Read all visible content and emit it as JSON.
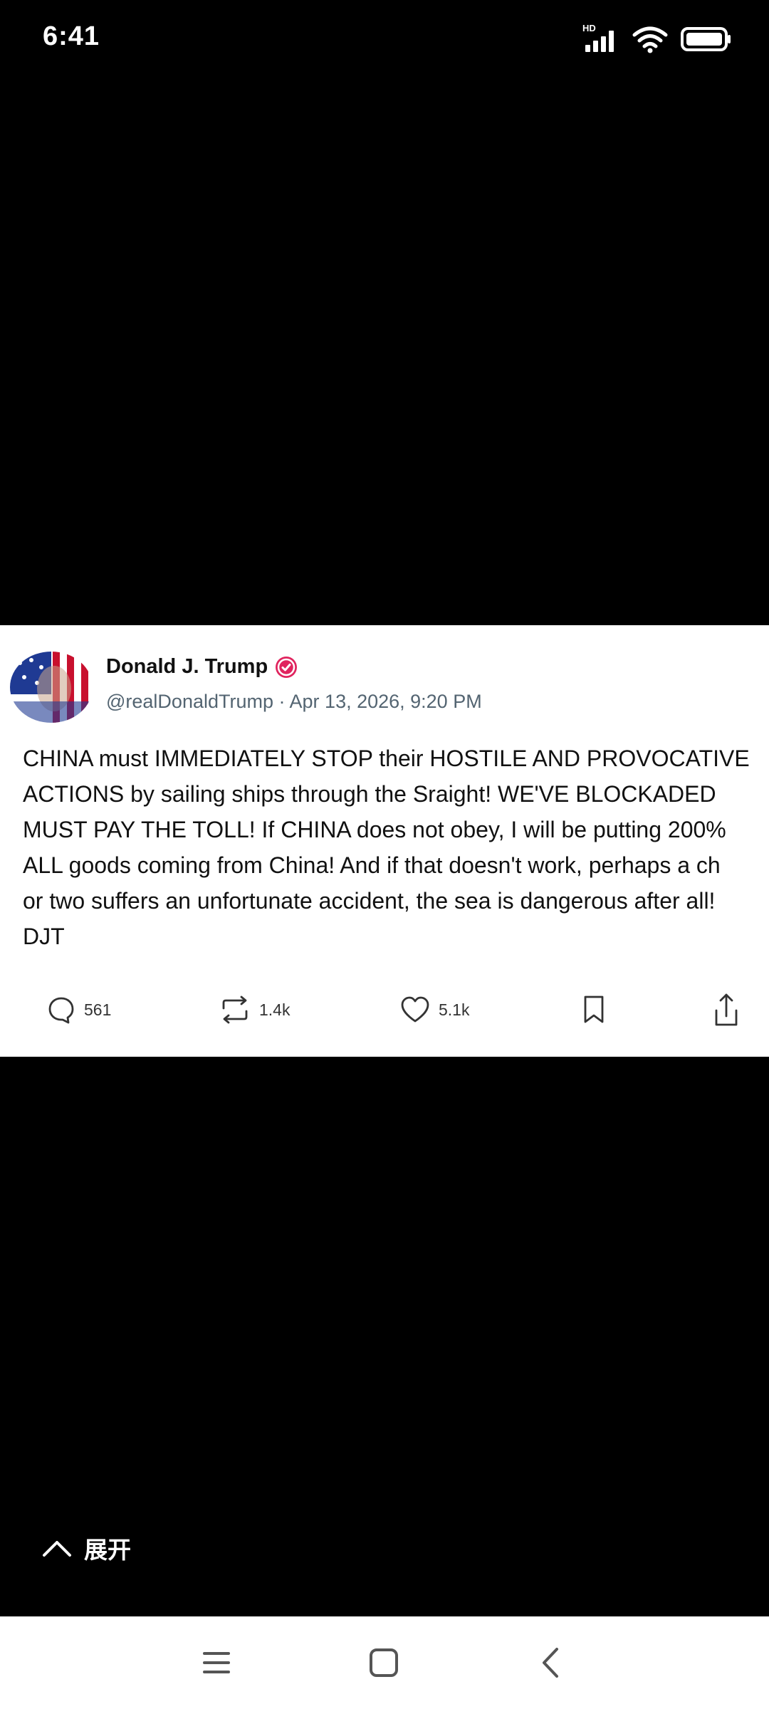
{
  "status_bar": {
    "time": "6:41",
    "network_badge": "HD",
    "icons": [
      "signal-icon",
      "wifi-icon",
      "battery-icon"
    ]
  },
  "tweet": {
    "author_name": "Donald J. Trump",
    "handle": "@realDonaldTrump",
    "separator": "·",
    "timestamp": "Apr 13, 2026, 9:20 PM",
    "body_lines": [
      "CHINA must IMMEDIATELY STOP their HOSTILE AND PROVOCATIVE",
      "ACTIONS by sailing ships through the Sraight! WE'VE BLOCKADED",
      "MUST PAY THE TOLL! If CHINA does not obey, I will be putting 200%",
      "ALL goods coming from China! And if that doesn't work, perhaps a ch",
      "or two suffers an unfortunate accident, the sea is dangerous after all!",
      "DJT"
    ],
    "replies": "561",
    "reposts": "1.4k",
    "likes": "5.1k",
    "verified_color": "#e0245e"
  },
  "expand": {
    "label": "展开"
  },
  "nav": {
    "buttons": [
      "menu-icon",
      "home-icon",
      "back-icon"
    ]
  }
}
